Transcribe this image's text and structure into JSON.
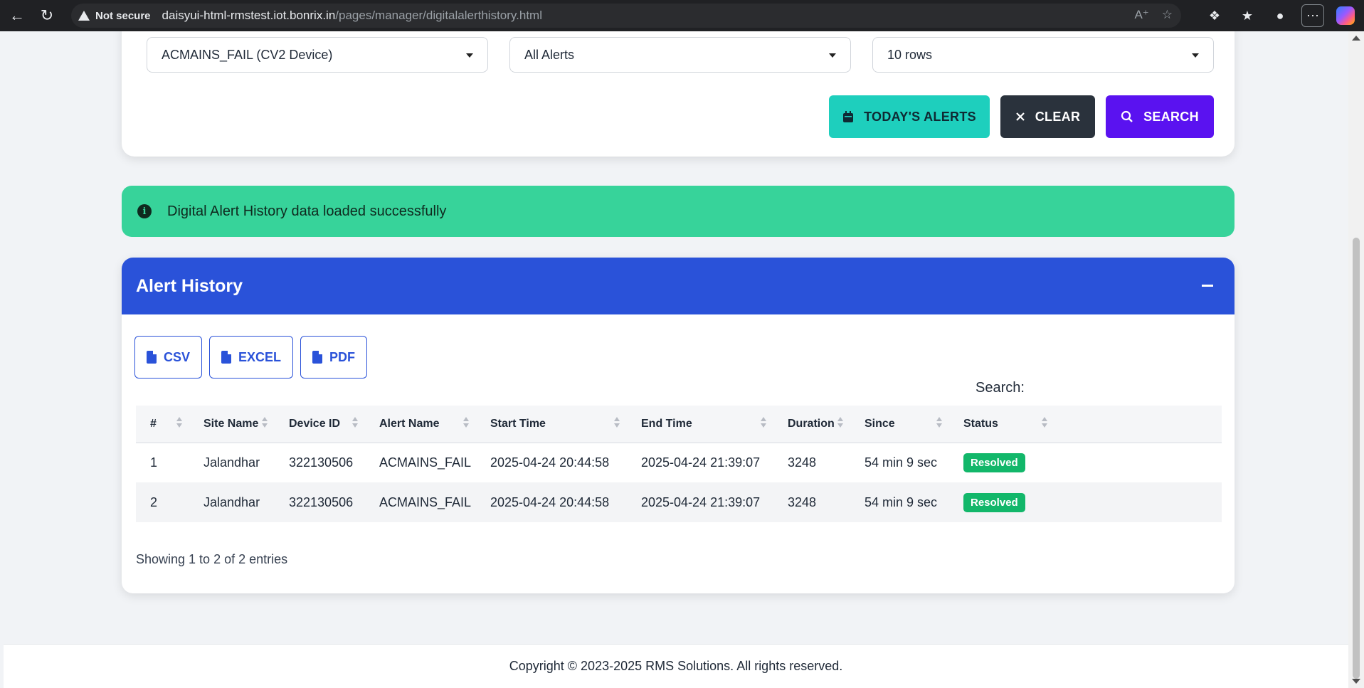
{
  "browser": {
    "not_secure": "Not secure",
    "url_host": "daisyui-html-rmstest.iot.bonrix.in",
    "url_path": "/pages/manager/digitalalerthistory.html"
  },
  "filters": {
    "device_select": "ACMAINS_FAIL (CV2 Device)",
    "alert_select": "All Alerts",
    "rows_select": "10 rows"
  },
  "buttons": {
    "today": "TODAY'S ALERTS",
    "clear": "CLEAR",
    "search": "SEARCH"
  },
  "alert": {
    "message": "Digital Alert History data loaded successfully"
  },
  "history": {
    "title": "Alert History",
    "export": {
      "csv": "CSV",
      "excel": "EXCEL",
      "pdf": "PDF"
    },
    "search_label": "Search:",
    "columns": [
      "#",
      "Site Name",
      "Device ID",
      "Alert Name",
      "Start Time",
      "End Time",
      "Duration",
      "Since",
      "Status"
    ],
    "rows": [
      {
        "num": "1",
        "site": "Jalandhar",
        "device": "322130506",
        "alert": "ACMAINS_FAIL",
        "start": "2025-04-24 20:44:58",
        "end": "2025-04-24 21:39:07",
        "duration": "3248",
        "since": "54 min 9 sec",
        "status": "Resolved"
      },
      {
        "num": "2",
        "site": "Jalandhar",
        "device": "322130506",
        "alert": "ACMAINS_FAIL",
        "start": "2025-04-24 20:44:58",
        "end": "2025-04-24 21:39:07",
        "duration": "3248",
        "since": "54 min 9 sec",
        "status": "Resolved"
      }
    ],
    "showing": "Showing 1 to 2 of 2 entries"
  },
  "footer": {
    "copyright": "Copyright © 2023-2025 RMS Solutions. All rights reserved."
  },
  "colors": {
    "primary": "#2a52d9",
    "teal": "#1ecfbd",
    "dark": "#2a323c",
    "purple": "#5a12f0",
    "success": "#37d39a",
    "badge": "#12b76a"
  }
}
